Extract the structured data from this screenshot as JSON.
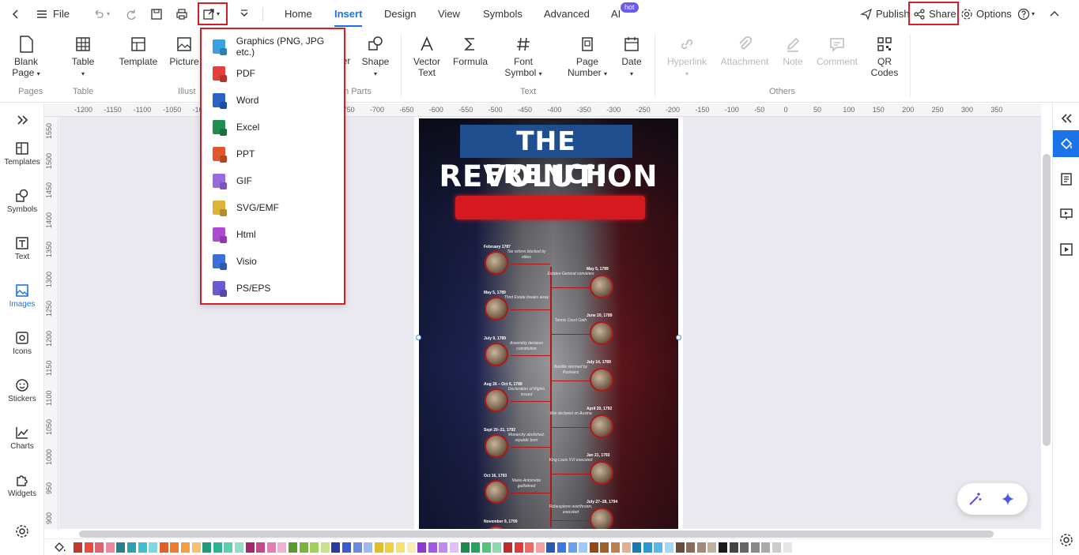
{
  "titlebar": {
    "file_label": "File",
    "tabs": [
      "Home",
      "Insert",
      "Design",
      "View",
      "Symbols",
      "Advanced",
      "AI"
    ],
    "active_tab": "Insert",
    "ai_badge": "hot",
    "publish_label": "Publish",
    "share_label": "Share",
    "options_label": "Options"
  },
  "ribbon": {
    "blank_page": "Blank Page",
    "table": "Table",
    "template": "Template",
    "picture": "Picture",
    "partial_er": "er",
    "shape": "Shape",
    "vector_text": "Vector Text",
    "formula": "Formula",
    "font_symbol": "Font Symbol",
    "page_number": "Page Number",
    "date": "Date",
    "hyperlink": "Hyperlink",
    "attachment": "Attachment",
    "note": "Note",
    "comment": "Comment",
    "qr_codes": "QR Codes",
    "groups": {
      "pages": "Pages",
      "table": "Table",
      "illust": "Illust",
      "m_parts": "m Parts",
      "text": "Text",
      "others": "Others"
    }
  },
  "export_menu": {
    "items": [
      {
        "label": "Graphics (PNG, JPG etc.)",
        "color": "#3aa0e0"
      },
      {
        "label": "PDF",
        "color": "#e0413a"
      },
      {
        "label": "Word",
        "color": "#2b62c8"
      },
      {
        "label": "Excel",
        "color": "#1f8f4e"
      },
      {
        "label": "PPT",
        "color": "#e2572c"
      },
      {
        "label": "GIF",
        "color": "#9a6ae0"
      },
      {
        "label": "SVG/EMF",
        "color": "#e0b23a"
      },
      {
        "label": "Html",
        "color": "#b04ad6"
      },
      {
        "label": "Visio",
        "color": "#3a6fd8"
      },
      {
        "label": "PS/EPS",
        "color": "#6a5ad6"
      }
    ]
  },
  "sidebar": {
    "items": [
      "Templates",
      "Symbols",
      "Text",
      "Images",
      "Icons",
      "Stickers",
      "Charts",
      "Widgets"
    ],
    "active": "Images"
  },
  "ruler": {
    "h_labels": [
      "-1200",
      "-1150",
      "-1100",
      "-1050",
      "-1000",
      "-950",
      "-900",
      "-850",
      "-800",
      "-750",
      "-700",
      "-650",
      "-600",
      "-550",
      "-500",
      "-450",
      "-400",
      "-350",
      "-300",
      "-250",
      "-200",
      "-150",
      "-100",
      "-50",
      "0",
      "50",
      "100",
      "150",
      "200",
      "250",
      "300",
      "350"
    ],
    "v_labels": [
      "1550",
      "1500",
      "1450",
      "1400",
      "1350",
      "1300",
      "1250",
      "1200",
      "1150",
      "1100",
      "1050",
      "1000",
      "950",
      "900"
    ]
  },
  "poster": {
    "title_line1": "THE FRENCH",
    "title_line2": "REVOLUTION",
    "events_left": [
      {
        "date": "February 1787",
        "desc": "Tax reform blocked by elites"
      },
      {
        "date": "May 5, 1789",
        "desc": "Third Estate breaks away"
      },
      {
        "date": "July 9, 1789",
        "desc": "Assembly declares constitution"
      },
      {
        "date": "Aug 26 – Oct 6, 1789",
        "desc": "Declaration of Rights issued"
      },
      {
        "date": "Sept 20–21, 1792",
        "desc": "Monarchy abolished, republic born"
      },
      {
        "date": "Oct 16, 1793",
        "desc": "Marie-Antoinette guillotined"
      },
      {
        "date": "November 9, 1799",
        "desc": ""
      }
    ],
    "events_right": [
      {
        "date": "May 5, 1789",
        "desc": "Estates-General convenes"
      },
      {
        "date": "June 20, 1789",
        "desc": "Tennis Court Oath"
      },
      {
        "date": "July 14, 1789",
        "desc": "Bastille stormed by Parisians"
      },
      {
        "date": "April 20, 1792",
        "desc": "War declared on Austria"
      },
      {
        "date": "Jan 21, 1793",
        "desc": "King Louis XVI executed"
      },
      {
        "date": "July 27–28, 1794",
        "desc": "Robespierre overthrown, executed"
      }
    ]
  },
  "palette": [
    "#c0392b",
    "#e74c3c",
    "#e06070",
    "#e98aa0",
    "#2a7f8f",
    "#2aa0b0",
    "#3ec0cf",
    "#7fd8e0",
    "#e0602a",
    "#f07a30",
    "#f5a040",
    "#f7c070",
    "#1f9a7a",
    "#2ab590",
    "#5ad0b0",
    "#90e0c8",
    "#a02a6a",
    "#c04a8a",
    "#e080b0",
    "#f0b0d0",
    "#5a9a2a",
    "#7ab53a",
    "#a0cf5a",
    "#c8e090",
    "#2a3aa0",
    "#3a5ad0",
    "#6a8ae0",
    "#a0b8f0",
    "#e0c02a",
    "#f0d040",
    "#f5e070",
    "#f8ee b0",
    "#8a3ad0",
    "#a05ae0",
    "#c08af0",
    "#e0c0f8",
    "#1f8a4e",
    "#2aa060",
    "#5ac080",
    "#90d8b0",
    "#c02a2a",
    "#e03a3a",
    "#f06a6a",
    "#f5a0a0",
    "#2a5ab0",
    "#3a7ae0",
    "#6aa0f0",
    "#a0c8f8",
    "#8a4a1a",
    "#a0602a",
    "#c0804a",
    "#e0b090",
    "#1a7ab0",
    "#2a9ad0",
    "#5ab8e8",
    "#a0d8f5",
    "#6a4a3a",
    "#8a6a5a",
    "#a08a7a",
    "#c0b0a0",
    "#1a1a1a",
    "#444444",
    "#666666",
    "#888888",
    "#aaaaaa",
    "#cccccc",
    "#e6e6e6",
    "#ffffff"
  ]
}
